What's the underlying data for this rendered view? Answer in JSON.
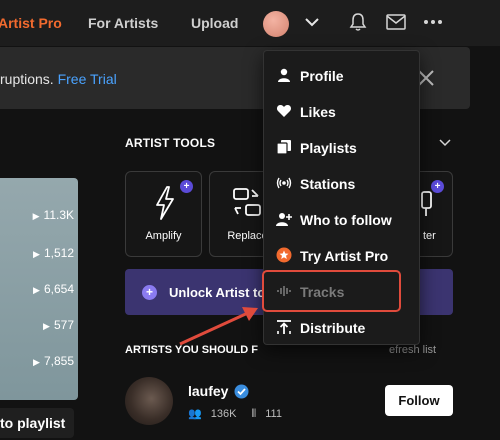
{
  "nav": {
    "artist_pro": "Artist Pro",
    "for_artists": "For Artists",
    "upload": "Upload"
  },
  "banner": {
    "text": "ruptions.",
    "link": "Free Trial"
  },
  "left_card": {
    "stats": [
      "11.3K",
      "1,512",
      "6,654",
      "577",
      "7,855"
    ],
    "playlist_button": "to playlist"
  },
  "artist_tools": {
    "heading": "ARTIST TOOLS",
    "tools": [
      "Amplify",
      "Replace",
      "ter"
    ],
    "unlock_text": "Unlock Artist too"
  },
  "artists": {
    "heading": "ARTISTS YOU SHOULD F",
    "refresh": "efresh list",
    "name": "laufey",
    "followers": "136K",
    "tracks": "111",
    "follow_button": "Follow"
  },
  "menu": {
    "items": [
      {
        "label": "Profile",
        "icon": "person-icon"
      },
      {
        "label": "Likes",
        "icon": "heart-icon"
      },
      {
        "label": "Playlists",
        "icon": "playlists-icon"
      },
      {
        "label": "Stations",
        "icon": "stations-icon"
      },
      {
        "label": "Who to follow",
        "icon": "add-person-icon"
      },
      {
        "label": "Try Artist Pro",
        "icon": "star-badge-icon"
      },
      {
        "label": "Tracks",
        "icon": "waveform-icon"
      },
      {
        "label": "Distribute",
        "icon": "distribute-icon"
      }
    ]
  },
  "colors": {
    "brand_orange": "#f26a2e",
    "link_blue": "#4aa3ff",
    "unlock_purple": "#3b3470",
    "highlight_red": "#e04b3c"
  }
}
